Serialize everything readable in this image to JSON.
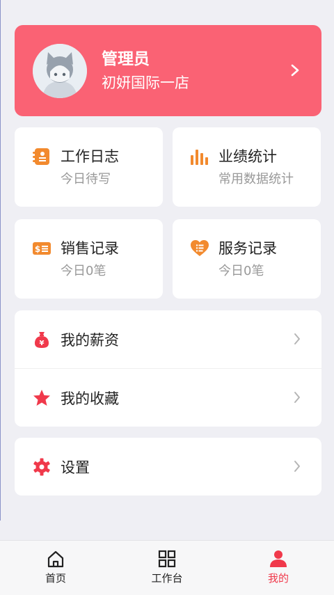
{
  "profile": {
    "name": "管理员",
    "store": "初妍国际一店"
  },
  "cards": [
    {
      "title": "工作日志",
      "subtitle": "今日待写",
      "icon": "notebook-icon"
    },
    {
      "title": "业绩统计",
      "subtitle": "常用数据统计",
      "icon": "bar-chart-icon"
    },
    {
      "title": "销售记录",
      "subtitle": "今日0笔",
      "icon": "dollar-receipt-icon"
    },
    {
      "title": "服务记录",
      "subtitle": "今日0笔",
      "icon": "heart-list-icon"
    }
  ],
  "menu": [
    {
      "label": "我的薪资",
      "icon": "money-bag-icon"
    },
    {
      "label": "我的收藏",
      "icon": "star-icon"
    }
  ],
  "settings": {
    "label": "设置",
    "icon": "gear-icon"
  },
  "tabs": [
    {
      "label": "首页",
      "icon": "home-icon"
    },
    {
      "label": "工作台",
      "icon": "grid-icon"
    },
    {
      "label": "我的",
      "icon": "person-icon",
      "active": true
    }
  ],
  "colors": {
    "brand": "#fa6274",
    "icon_orange": "#f28a2e",
    "accent_red": "#f0394b",
    "background": "#efeff4"
  }
}
